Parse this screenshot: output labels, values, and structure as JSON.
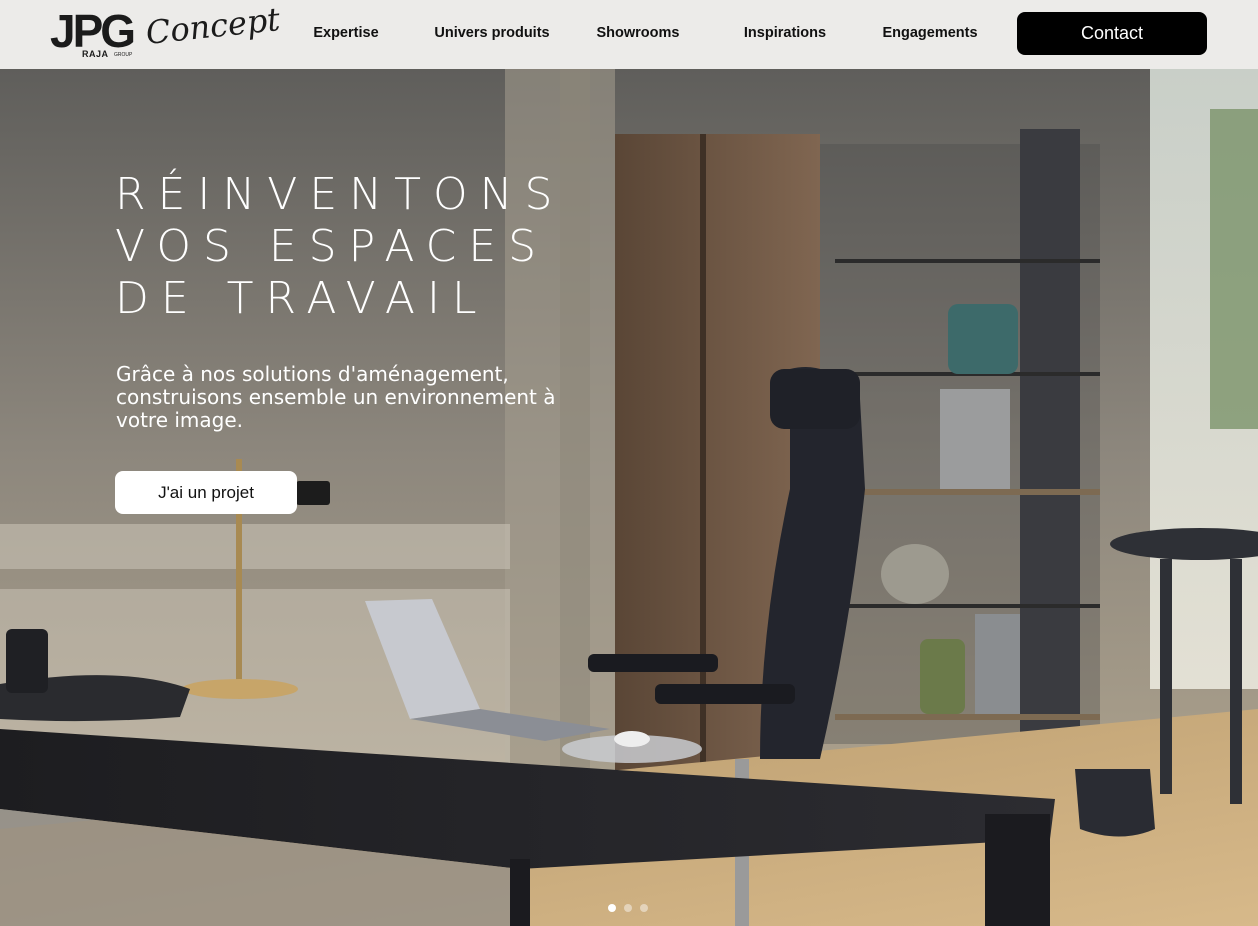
{
  "header": {
    "logo": {
      "mark": "JPG",
      "brand": "RAJA",
      "group": "GROUP",
      "script": "Concept"
    },
    "nav": [
      {
        "label": "Expertise"
      },
      {
        "label": "Univers produits"
      },
      {
        "label": "Showrooms"
      },
      {
        "label": "Inspirations"
      },
      {
        "label": "Engagements"
      }
    ],
    "contact_label": "Contact"
  },
  "hero": {
    "title_lines": [
      "RÉINVENTONS",
      "VOS ESPACES",
      "DE TRAVAIL"
    ],
    "subtitle": "Grâce à nos solutions d'aménagement, construisons ensemble un environnement à votre image.",
    "cta_label": "J'ai un projet",
    "slides": {
      "count": 3,
      "active": 1
    }
  },
  "colors": {
    "header_bg": "#ecebe9",
    "button_dark": "#000000",
    "button_light": "#ffffff",
    "brand_red": "#c8102e"
  }
}
